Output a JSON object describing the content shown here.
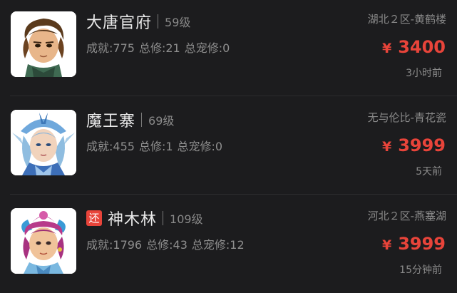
{
  "listings": [
    {
      "name": "大唐官府",
      "level": "59级",
      "tag": "",
      "stats": {
        "achievement": "成就:775",
        "cultivation": "总修:21",
        "pet_cultivation": "总宠修:0"
      },
      "server": "湖北２区-黄鹤楼",
      "currency": "¥",
      "price": "3400",
      "time": "3小时前",
      "avatar_icon": "warrior-avatar-icon"
    },
    {
      "name": "魔王寨",
      "level": "69级",
      "tag": "",
      "stats": {
        "achievement": "成就:455",
        "cultivation": "总修:1",
        "pet_cultivation": "总宠修:0"
      },
      "server": "无与伦比-青花瓷",
      "currency": "¥",
      "price": "3999",
      "time": "5天前",
      "avatar_icon": "demon-king-avatar-icon"
    },
    {
      "name": "神木林",
      "level": "109级",
      "tag": "还",
      "stats": {
        "achievement": "成就:1796",
        "cultivation": "总修:43",
        "pet_cultivation": "总宠修:12"
      },
      "server": "河北２区-燕塞湖",
      "currency": "¥",
      "price": "3999",
      "time": "15分钟前",
      "avatar_icon": "forest-mage-avatar-icon"
    }
  ],
  "colors": {
    "background": "#1c1c1e",
    "price": "#e8443a",
    "tag": "#e8443a",
    "name": "#eaeaea",
    "secondary_text": "#8a8a8a"
  }
}
